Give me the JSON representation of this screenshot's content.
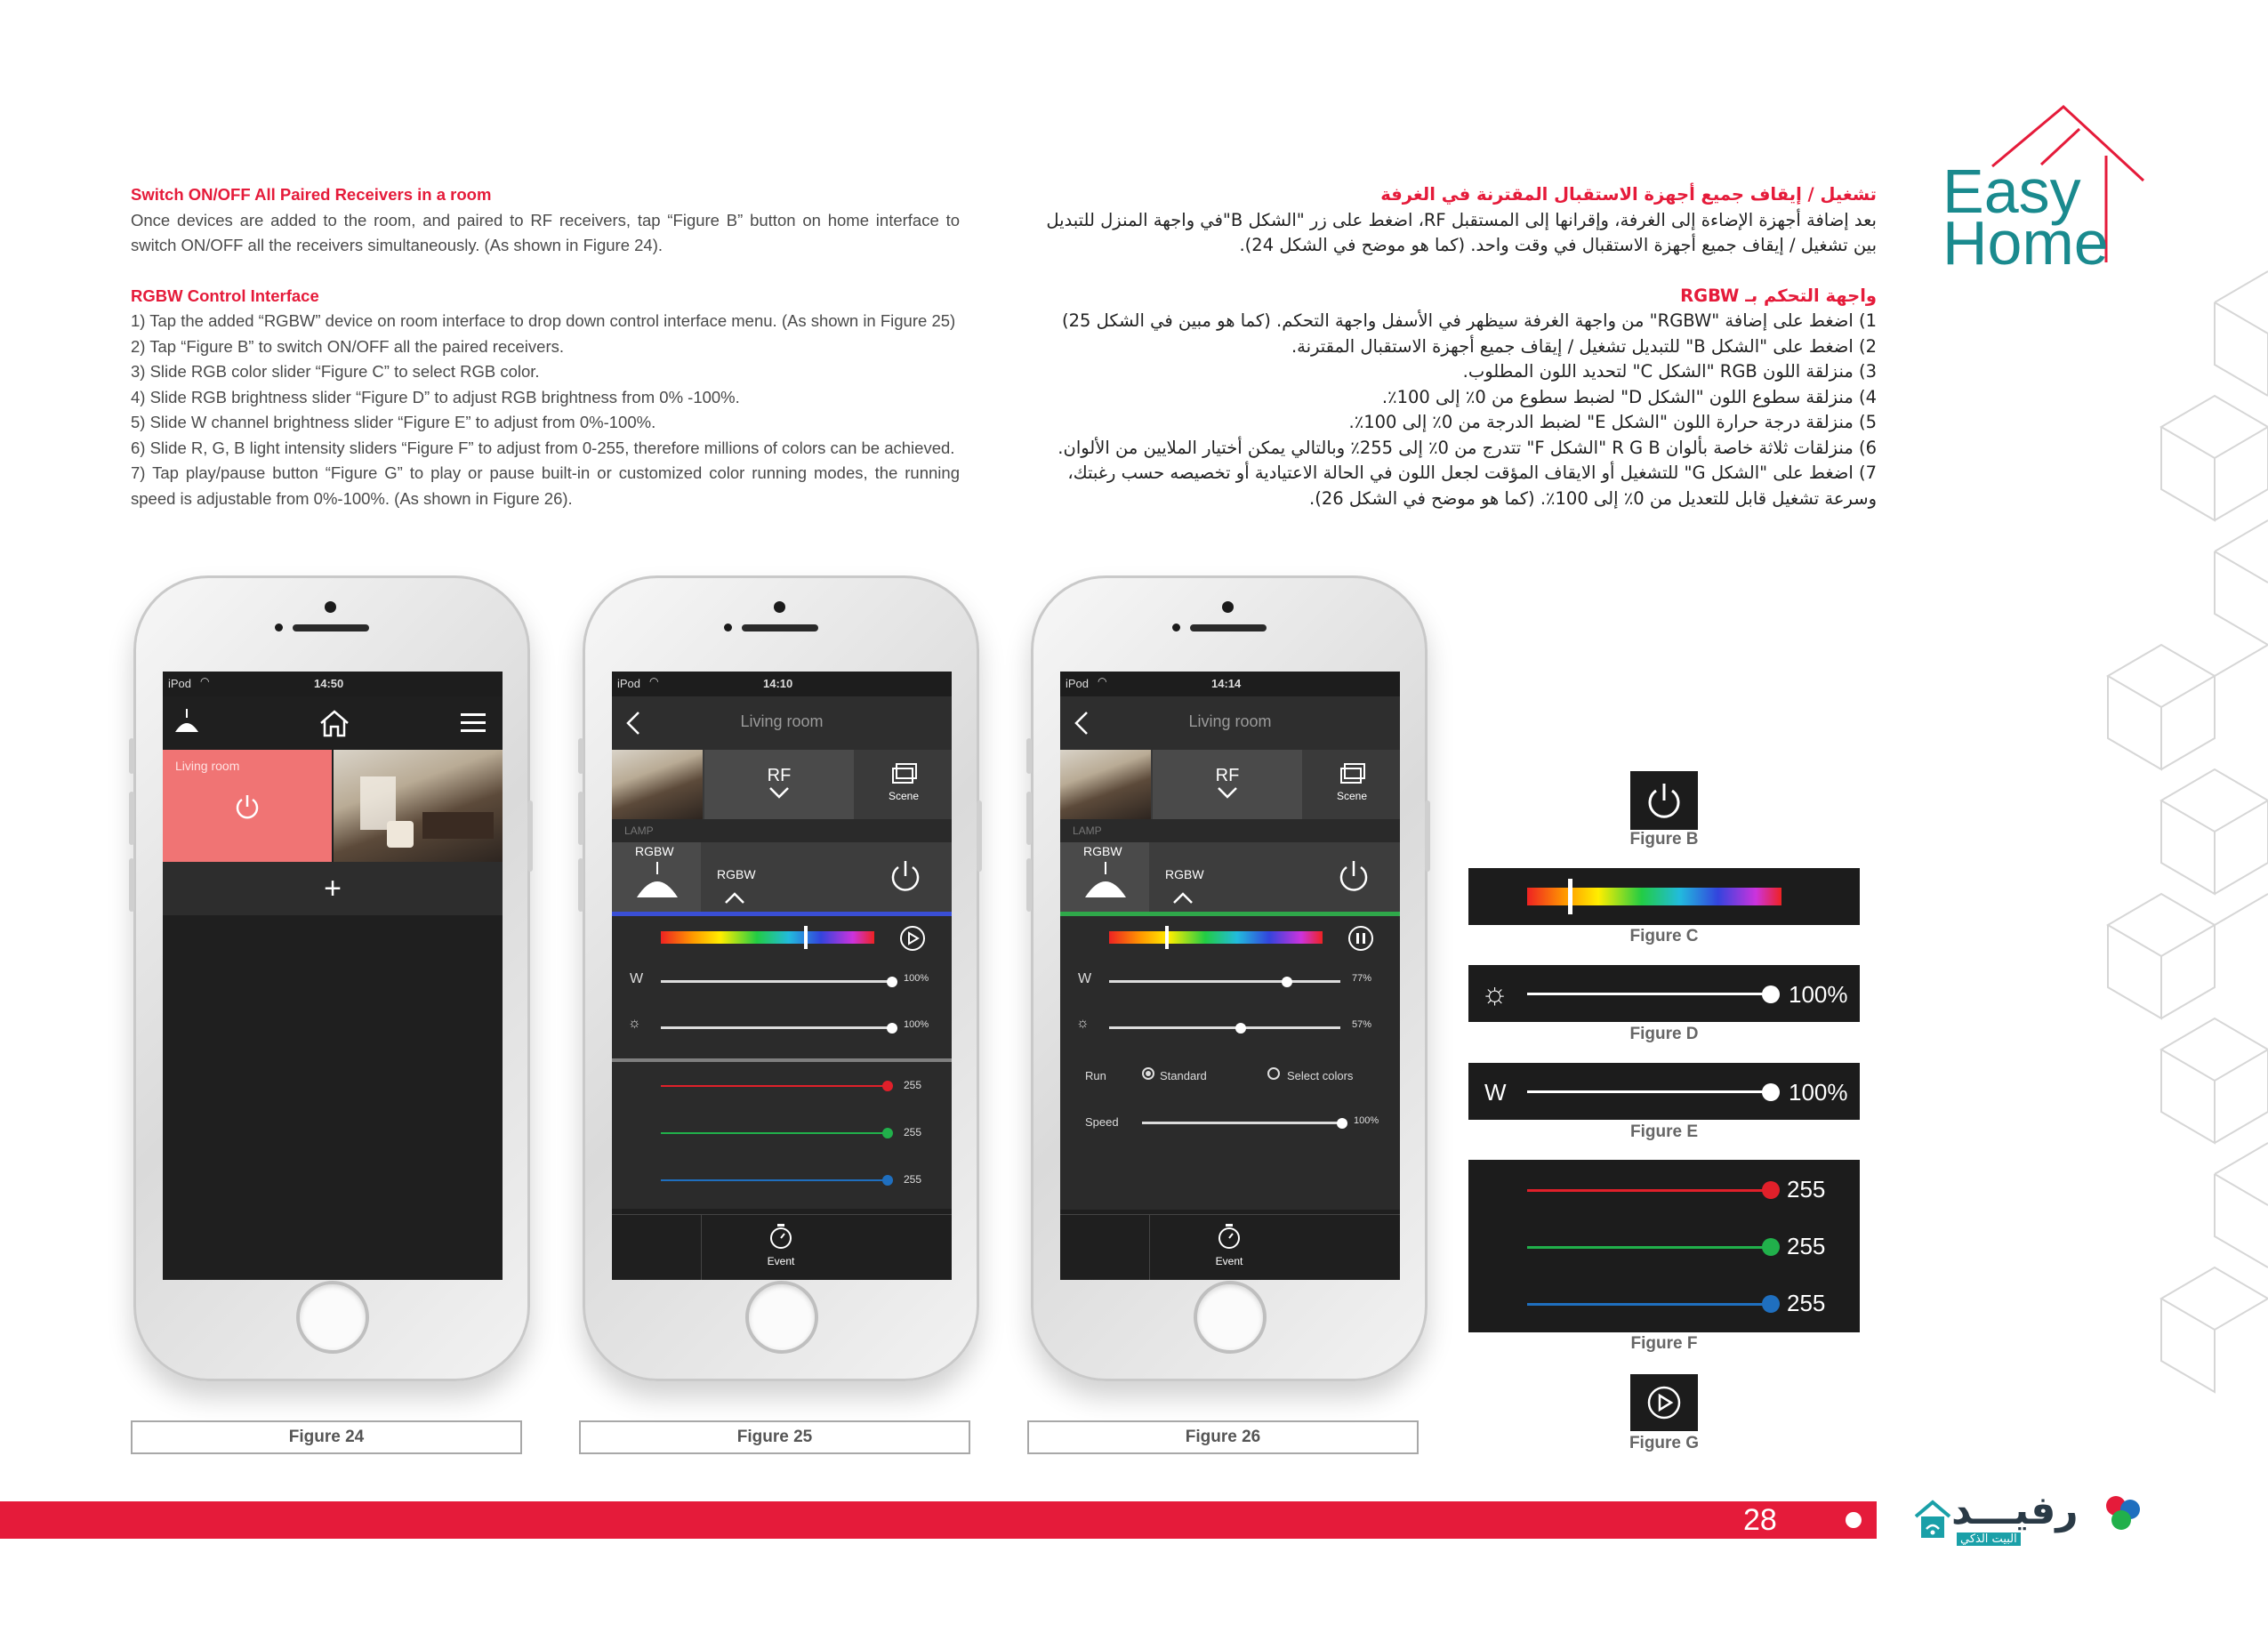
{
  "page": {
    "number": "28"
  },
  "logo": {
    "line1": "Easy",
    "line2": "Home"
  },
  "brand_bottom": {
    "name_ar": "رفيـــد",
    "tagline_ar": "البيت الذكي"
  },
  "english": {
    "section1_title": "Switch ON/OFF All Paired Receivers in a room",
    "section1_body": "Once devices are added to the room, and paired to RF receivers, tap “Figure B” button on home interface to switch ON/OFF all the receivers simultaneously. (As shown in Figure 24).",
    "section2_title": "RGBW Control Interface",
    "steps": [
      "1) Tap the added “RGBW” device on room interface to drop down control interface menu. (As shown in Figure 25)",
      "2) Tap “Figure B” to switch ON/OFF all the paired receivers.",
      "3) Slide RGB color slider “Figure C” to select RGB color.",
      "4) Slide RGB brightness slider “Figure D” to adjust RGB brightness from 0% -100%.",
      "5) Slide W channel brightness slider “Figure E” to adjust from 0%-100%.",
      "6) Slide R, G, B light intensity sliders “Figure F” to adjust from 0-255, therefore millions of colors can be achieved.",
      "7) Tap play/pause button “Figure G” to play or pause built-in or customized color running modes, the running speed is adjustable from 0%-100%. (As shown in Figure 26)."
    ]
  },
  "arabic": {
    "section1_title": "تشغيل / إيقاف جميع أجهزة الاستقبال المقترنة في الغرفة",
    "section1_body": "بعد إضافة أجهزة الإضاءة إلى الغرفة، وإقرانها إلى المستقبل RF، اضغط على زر \"الشكل B\"في واجهة المنزل للتبديل بين تشغيل / إيقاف جميع أجهزة الاستقبال في وقت واحد. (كما هو موضح في الشكل 24).",
    "section2_title": "واجهة التحكم بـ RGBW",
    "steps": [
      "1) اضغط على إضافة \"RGBW\" من واجهة الغرفة سيظهر في الأسفل واجهة التحكم. (كما هو مبين في الشكل 25)",
      "2) اضغط على \"الشكل B\" للتبديل تشغيل / إيقاف جميع أجهزة الاستقبال المقترنة.",
      "3) منزلقة اللون RGB \"الشكل C\" لتحديد اللون المطلوب.",
      "4) منزلقة سطوع اللون \"الشكل D\" لضبط سطوع من 0٪ إلى 100٪.",
      "5) منزلقة درجة حرارة اللون \"الشكل E\" لضبط الدرجة من 0٪ إلى 100٪.",
      "6) منزلقات ثلاثة خاصة بألوان R G B \"الشكل F\" تتدرج من 0٪ إلى 255٪ وبالتالي يمكن أختيار الملايين من الألوان.",
      "7) اضغط على \"الشكل G\" للتشغيل أو الايقاف المؤقت لجعل اللون في الحالة الاعتيادية أو تخصيصه حسب رغبتك، وسرعة تشغيل قابل للتعديل من 0٪ إلى 100٪. (كما هو موضح في الشكل 26)."
    ]
  },
  "phone1": {
    "status_left": "iPod",
    "time": "14:50",
    "room_label": "Living room",
    "add_symbol": "+",
    "caption": "Figure 24"
  },
  "phone2": {
    "status_left": "iPod",
    "time": "14:10",
    "title": "Living room",
    "rf_label": "RF",
    "scene_label": "Scene",
    "lamp_label": "LAMP",
    "rgbw_label": "RGBW",
    "rgbw_tab": "RGBW",
    "w_label": "W",
    "w_value": "100%",
    "w_level": 1.0,
    "brightness_value": "100%",
    "brightness_level": 1.0,
    "rgb_values": [
      "255",
      "255",
      "255"
    ],
    "color_pos": 0.68,
    "event_label": "Event",
    "caption": "Figure 25"
  },
  "phone3": {
    "status_left": "iPod",
    "time": "14:14",
    "title": "Living room",
    "rf_label": "RF",
    "scene_label": "Scene",
    "lamp_label": "LAMP",
    "rgbw_label": "RGBW",
    "rgbw_tab": "RGBW",
    "w_label": "W",
    "w_value": "77%",
    "w_level": 0.77,
    "brightness_value": "57%",
    "brightness_level": 0.57,
    "run_label": "Run",
    "run_option1": "Standard",
    "run_option2": "Select colors",
    "speed_label": "Speed",
    "speed_value": "100%",
    "speed_level": 1.0,
    "color_pos": 0.27,
    "event_label": "Event",
    "caption": "Figure 26"
  },
  "figures": {
    "b_label": "Figure B",
    "c_label": "Figure C",
    "c_pos": 0.17,
    "d_label": "Figure D",
    "d_value": "100%",
    "d_level": 1.0,
    "e_label": "Figure E",
    "e_symbol": "W",
    "e_value": "100%",
    "e_level": 1.0,
    "f_label": "Figure F",
    "f_values": [
      "255",
      "255",
      "255"
    ],
    "g_label": "Figure G"
  },
  "colors": {
    "accent_red": "#e51b3a",
    "logo_teal": "#1a8a8e",
    "slider_red": "#e0202a",
    "slider_green": "#21b04b",
    "slider_blue": "#1f6fbf"
  }
}
